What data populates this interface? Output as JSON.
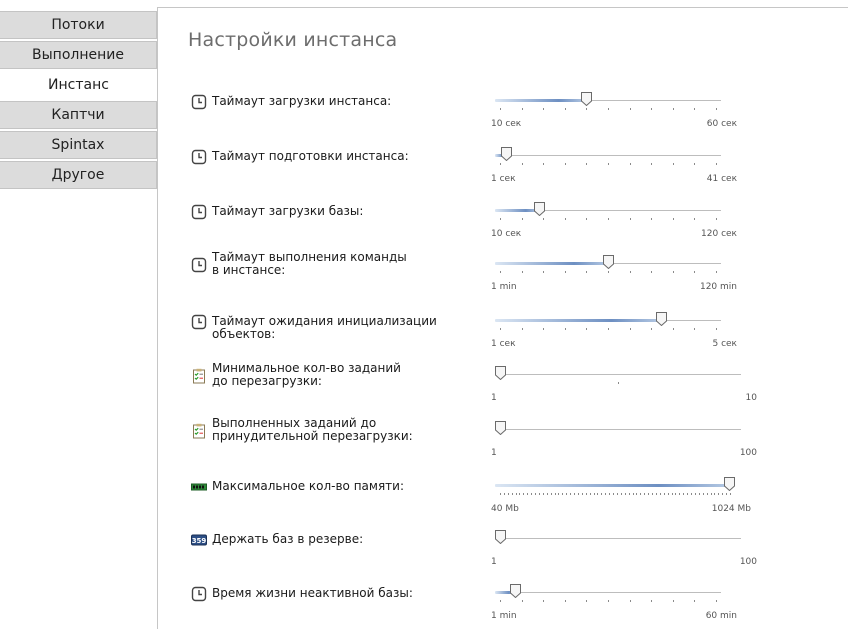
{
  "sidebar": {
    "items": [
      {
        "label": "Потоки",
        "active": false
      },
      {
        "label": "Выполнение",
        "active": false
      },
      {
        "label": "Инстанс",
        "active": true
      },
      {
        "label": "Каптчи",
        "active": false
      },
      {
        "label": "Spintax",
        "active": false
      },
      {
        "label": "Другое",
        "active": false
      }
    ]
  },
  "main": {
    "title": "Настройки инстанса"
  },
  "settings": [
    {
      "label": "Таймаут загрузки инстанса:",
      "icon": "stopwatch-icon",
      "min": "10 сек",
      "max": "60 сек",
      "value_fraction": 0.4
    },
    {
      "label": "Таймаут подготовки инстанса:",
      "icon": "stopwatch-icon",
      "min": "1 сек",
      "max": "41 сек",
      "value_fraction": 0.03
    },
    {
      "label": "Таймаут загрузки базы:",
      "icon": "stopwatch-icon",
      "min": "10 сек",
      "max": "120 сек",
      "value_fraction": 0.18
    },
    {
      "label": "Таймаут выполнения команды\nв инстансе:",
      "icon": "stopwatch-icon",
      "min": "1 min",
      "max": "120 min",
      "value_fraction": 0.5
    },
    {
      "label": "Таймаут ожидания инициализации объектов:",
      "icon": "stopwatch-icon",
      "min": "1 сек",
      "max": "5 сек",
      "value_fraction": 0.75
    },
    {
      "label": "Минимальное кол-во заданий\nдо перезагрузки:",
      "icon": "checklist-icon",
      "min": "1",
      "max": "10",
      "value_fraction": 0.0
    },
    {
      "label": "Выполненных заданий до\nпринудительной перезагрузки:",
      "icon": "checklist-icon",
      "min": "1",
      "max": "100",
      "value_fraction": 0.0
    },
    {
      "label": "Максимальное кол-во памяти:",
      "icon": "memory-icon",
      "min": "40 Mb",
      "max": "1024 Mb",
      "value_fraction": 1.0
    },
    {
      "label": "Держать баз в резерве:",
      "icon": "database-counter-icon",
      "min": "1",
      "max": "100",
      "value_fraction": 0.0
    },
    {
      "label": "Время жизни неактивной базы:",
      "icon": "stopwatch-icon",
      "min": "1 min",
      "max": "60 min",
      "value_fraction": 0.07
    }
  ]
}
